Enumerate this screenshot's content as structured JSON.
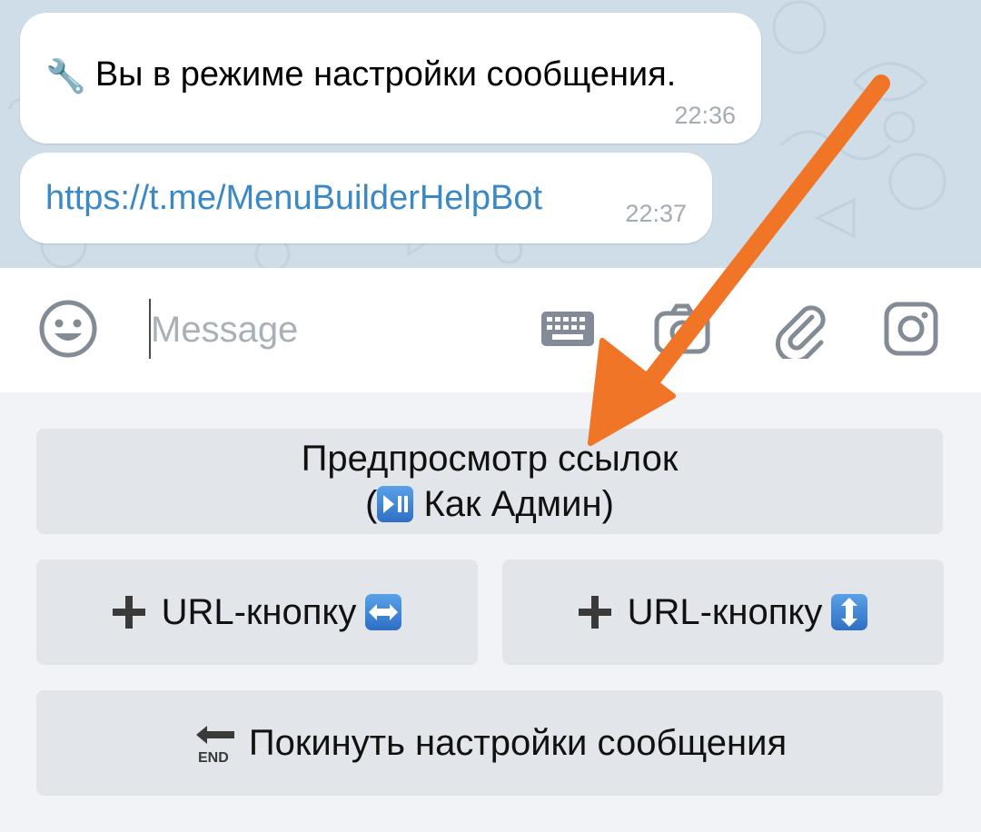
{
  "chat": {
    "messages": [
      {
        "icon": "wrench-icon",
        "text": "Вы в режиме настройки сообщения.",
        "time": "22:36"
      },
      {
        "text": "https://t.me/MenuBuilderHelpBot",
        "time": "22:37"
      }
    ]
  },
  "composer": {
    "placeholder": "Message",
    "value": ""
  },
  "keyboard": {
    "preview_line1": "Предпросмотр ссылок",
    "preview_line2_prefix": "(",
    "preview_line2_suffix": " Как Админ)",
    "preview_icon": "play-pause-icon",
    "url_button_label": "URL-кнопку",
    "url_h_icon": "left-right-arrow-icon",
    "url_v_icon": "up-down-arrow-icon",
    "leave_label": "Покинуть настройки сообщения",
    "leave_icon": "end-arrow-icon",
    "plus_icon": "plus-icon"
  },
  "colors": {
    "link": "#3a88c6",
    "annotation_arrow": "#f07526",
    "chat_background": "#cfdde8",
    "keyboard_button": "#e2e6ea",
    "emoji_blue": "#2f6fc4"
  }
}
